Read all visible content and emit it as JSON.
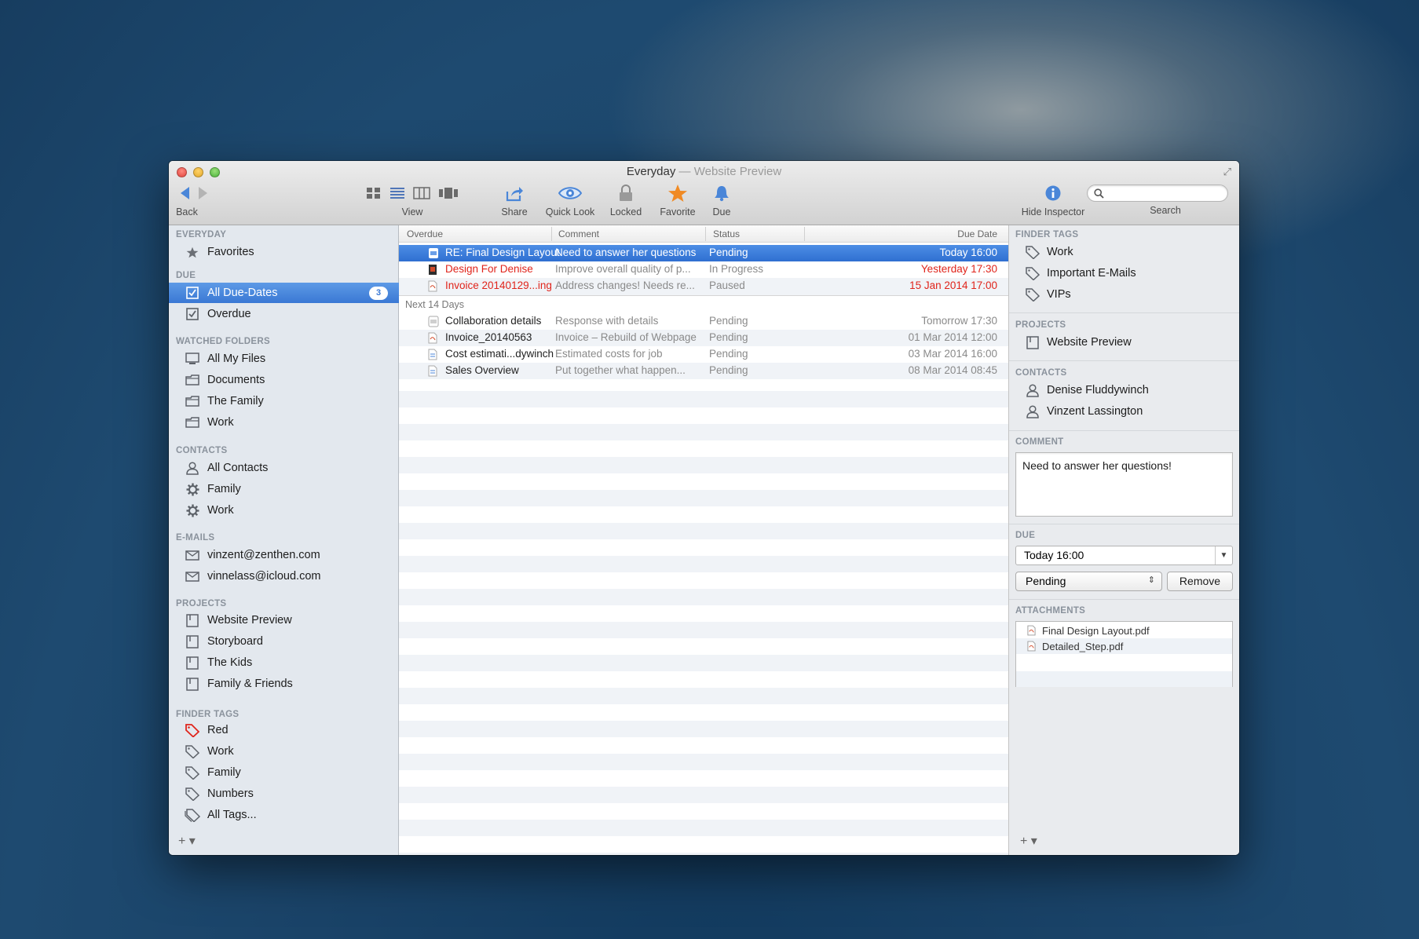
{
  "window": {
    "title": "Everyday",
    "title_sep": " — ",
    "subtitle": "Website Preview"
  },
  "toolbar": {
    "back_label": "Back",
    "view_label": "View",
    "share_label": "Share",
    "quicklook_label": "Quick Look",
    "locked_label": "Locked",
    "favorite_label": "Favorite",
    "due_label": "Due",
    "hide_inspector_label": "Hide Inspector",
    "search_label": "Search",
    "search_value": ""
  },
  "sidebar": {
    "everyday_head": "EVERYDAY",
    "favorites": "Favorites",
    "due_head": "DUE",
    "all_due_dates": "All Due-Dates",
    "all_due_dates_count": "3",
    "overdue": "Overdue",
    "watched_head": "WATCHED FOLDERS",
    "watched": [
      "All My Files",
      "Documents",
      "The Family",
      "Work"
    ],
    "contacts_head": "CONTACTS",
    "contacts": [
      "All Contacts",
      "Family",
      "Work"
    ],
    "emails_head": "E-MAILS",
    "emails": [
      "vinzent@zenthen.com",
      "vinnelass@icloud.com"
    ],
    "projects_head": "PROJECTS",
    "projects": [
      "Website Preview",
      "Storyboard",
      "The Kids",
      "Family & Friends"
    ],
    "tags_head": "FINDER TAGS",
    "tags": [
      "Red",
      "Work",
      "Family",
      "Numbers",
      "All Tags..."
    ],
    "footer": "+ ▾"
  },
  "list": {
    "headers": {
      "overdue": "Overdue",
      "comment": "Comment",
      "status": "Status",
      "due": "Due Date"
    },
    "overdue_rows": [
      {
        "name": "RE: Final Design Layout",
        "comment": "Need to answer her questions",
        "status": "Pending",
        "due": "Today 16:00"
      },
      {
        "name": "Design For Denise",
        "comment": "Improve overall quality of p...",
        "status": "In Progress",
        "due": "Yesterday 17:30"
      },
      {
        "name": "Invoice 20140129...ing",
        "comment": "Address changes! Needs re...",
        "status": "Paused",
        "due": "15 Jan 2014 17:00"
      }
    ],
    "next_head": "Next 14 Days",
    "next_rows": [
      {
        "name": "Collaboration details",
        "comment": "Response with details",
        "status": "Pending",
        "due": "Tomorrow 17:30"
      },
      {
        "name": "Invoice_20140563",
        "comment": "Invoice – Rebuild of Webpage",
        "status": "Pending",
        "due": "01 Mar 2014 12:00"
      },
      {
        "name": "Cost estimati...dywinch",
        "comment": "Estimated costs for job",
        "status": "Pending",
        "due": "03 Mar 2014 16:00"
      },
      {
        "name": "Sales Overview",
        "comment": "Put together what happen...",
        "status": "Pending",
        "due": "08 Mar 2014 08:45"
      }
    ]
  },
  "inspector": {
    "tags_head": "FINDER TAGS",
    "tags": [
      "Work",
      "Important E-Mails",
      "VIPs"
    ],
    "projects_head": "PROJECTS",
    "projects": [
      "Website Preview"
    ],
    "contacts_head": "CONTACTS",
    "contacts": [
      "Denise Fluddywinch",
      "Vinzent Lassington"
    ],
    "comment_head": "COMMENT",
    "comment": "Need to answer her questions!",
    "due_head": "DUE",
    "due_value": "Today 16:00",
    "status_value": "Pending",
    "remove_label": "Remove",
    "attachments_head": "ATTACHMENTS",
    "attachments": [
      "Final Design Layout.pdf",
      "Detailed_Step.pdf"
    ],
    "footer": "+ ▾"
  },
  "colors": {
    "accent": "#3a78d4",
    "overdue_red": "#e0241b",
    "favorite_orange": "#f08a24"
  }
}
